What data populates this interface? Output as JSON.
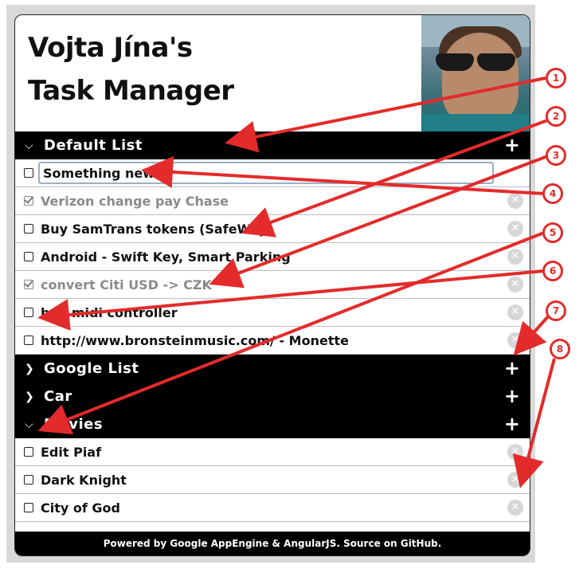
{
  "app": {
    "title_line1": "Vojta Jína's",
    "title_line2": "Task Manager"
  },
  "lists": [
    {
      "name": "Default List",
      "expanded": true,
      "tasks": [
        {
          "text": "Something new",
          "done": false,
          "editing": true
        },
        {
          "text": "Verizon change pay Chase",
          "done": true
        },
        {
          "text": "Buy SamTrans tokens (SafeWay)",
          "done": false
        },
        {
          "text": "Android - Swift Key, Smart Parking",
          "done": false
        },
        {
          "text": "convert Citi USD -> CZK",
          "done": true
        },
        {
          "text": "buy midi controller",
          "done": false
        },
        {
          "text": "http://www.bronsteinmusic.com/ - Monette",
          "done": false
        }
      ]
    },
    {
      "name": "Google List",
      "expanded": false,
      "tasks": []
    },
    {
      "name": "Car",
      "expanded": false,
      "tasks": []
    },
    {
      "name": "Movies",
      "expanded": true,
      "tasks": [
        {
          "text": "Edit Piaf",
          "done": false
        },
        {
          "text": "Dark Knight",
          "done": false
        },
        {
          "text": "City of God",
          "done": false
        }
      ]
    }
  ],
  "footer": "Powered by Google AppEngine & AngularJS. Source on GitHub.",
  "annotations": [
    "1",
    "2",
    "3",
    "4",
    "5",
    "6",
    "7",
    "8"
  ],
  "icons": {
    "expanded": "chevron-down-icon",
    "collapsed": "chevron-right-icon",
    "add": "plus-icon",
    "delete": "delete-circle-icon",
    "checkbox": "checkbox-icon"
  },
  "colors": {
    "header_bg": "#000000",
    "done_text": "#8a8a8a",
    "annotation": "#e32b2b"
  }
}
